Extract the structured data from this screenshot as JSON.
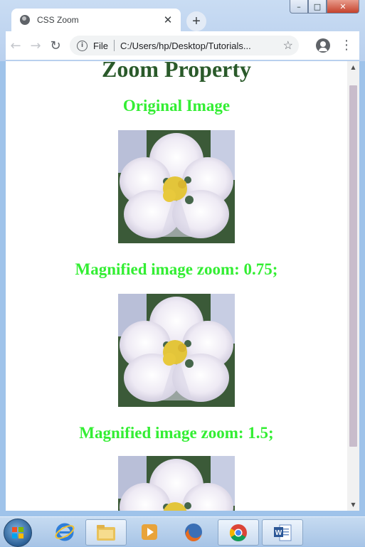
{
  "browser": {
    "tab": {
      "title": "CSS Zoom",
      "close_glyph": "✕"
    },
    "new_tab_glyph": "+",
    "toolbar": {
      "back_glyph": "←",
      "forward_glyph": "→",
      "reload_glyph": "↻",
      "scheme_label": "File",
      "url": "C:/Users/hp/Desktop/Tutorials...",
      "star_glyph": "☆",
      "menu_glyph": "⋮"
    },
    "window_controls": {
      "minimize": "–",
      "maximize": "□",
      "close": "✕"
    }
  },
  "page": {
    "title": "Zoom Property",
    "sections": [
      {
        "heading": "Original Image"
      },
      {
        "heading": "Magnified image zoom: 0.75;"
      },
      {
        "heading": "Magnified image zoom: 1.5;"
      }
    ]
  },
  "taskbar": {
    "items": [
      "start-button",
      "internet-explorer-icon",
      "file-explorer-icon",
      "media-player-icon",
      "firefox-icon",
      "chrome-icon",
      "word-icon"
    ]
  }
}
